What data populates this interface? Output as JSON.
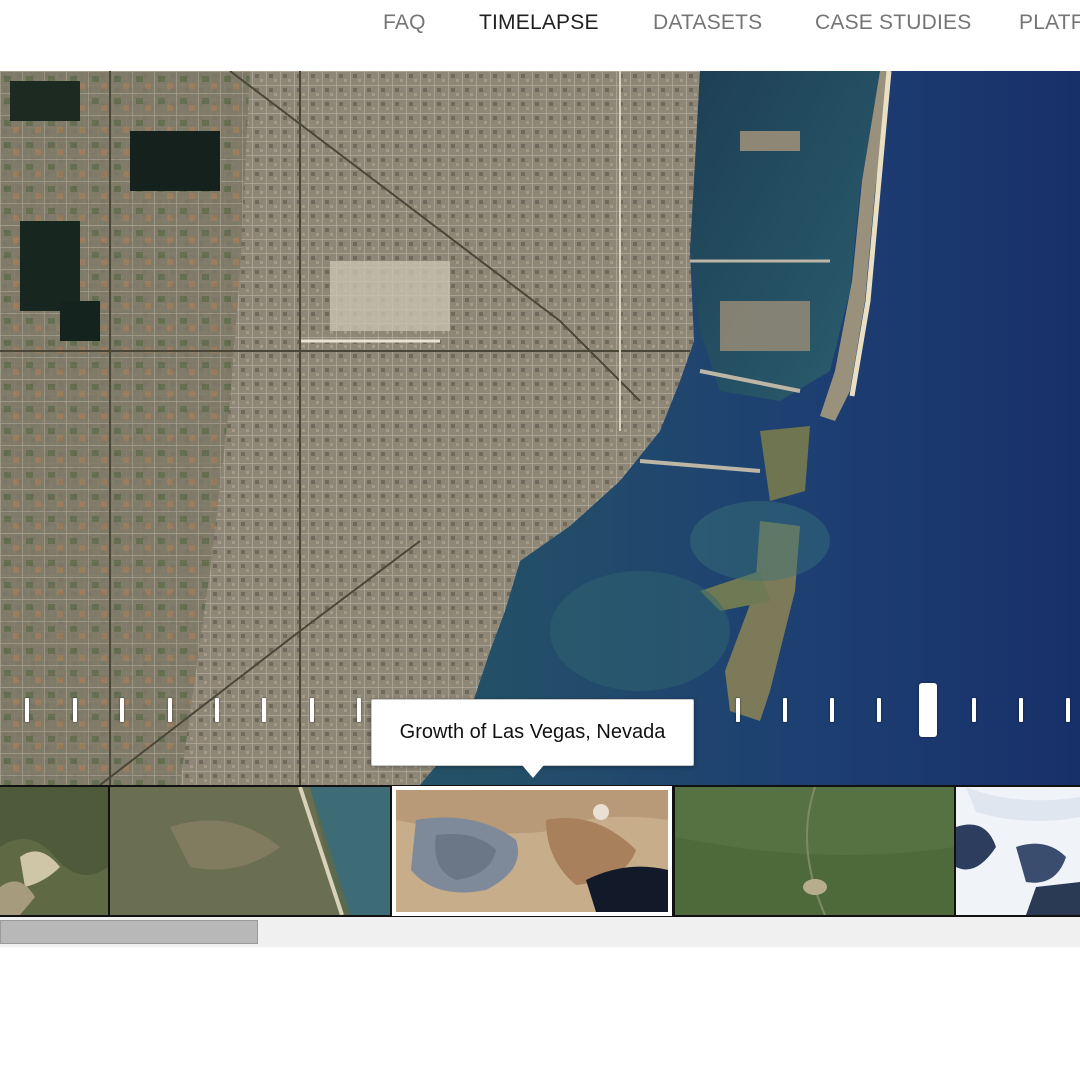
{
  "nav": {
    "items": [
      {
        "label": "FAQ",
        "active": false
      },
      {
        "label": "TIMELAPSE",
        "active": true
      },
      {
        "label": "DATASETS",
        "active": false
      },
      {
        "label": "CASE STUDIES",
        "active": false
      },
      {
        "label": "PLATF",
        "active": false
      }
    ]
  },
  "viewer": {
    "tooltip": "Growth of Las Vegas, Nevada"
  },
  "thumbnails": {
    "selected_index": 2
  },
  "colors": {
    "ocean": "#1f3f72",
    "land": "#8a8272",
    "selection_outline": "#ffffff",
    "nav_active": "#202020",
    "nav_inactive": "#757575"
  }
}
